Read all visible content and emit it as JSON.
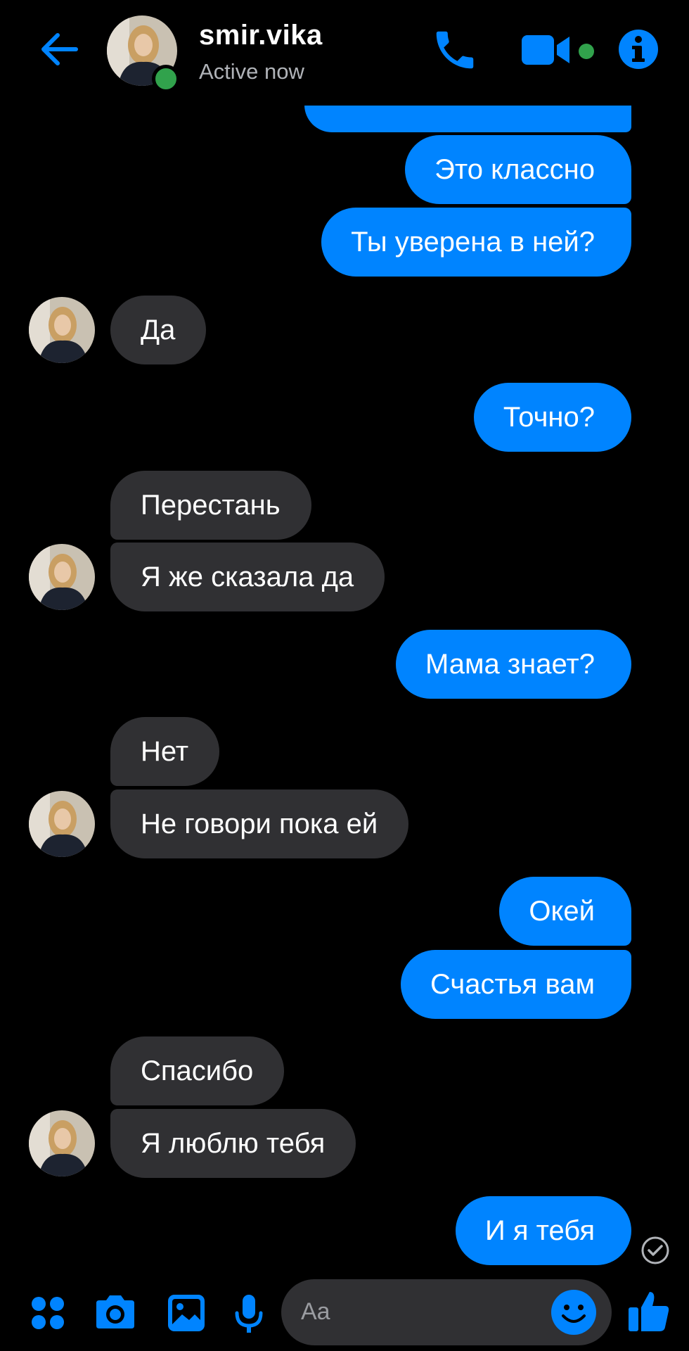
{
  "header": {
    "contact_name": "smir.vika",
    "status": "Active now"
  },
  "messages": [
    {
      "dir": "out",
      "text": "Это классно"
    },
    {
      "dir": "out",
      "text": "Ты уверена в ней?"
    },
    {
      "dir": "in",
      "text": "Да"
    },
    {
      "dir": "out",
      "text": "Точно?"
    },
    {
      "dir": "in",
      "text": "Перестань"
    },
    {
      "dir": "in",
      "text": "Я же сказала да"
    },
    {
      "dir": "out",
      "text": "Мама знает?"
    },
    {
      "dir": "in",
      "text": "Нет"
    },
    {
      "dir": "in",
      "text": "Не говори пока ей"
    },
    {
      "dir": "out",
      "text": "Окей"
    },
    {
      "dir": "out",
      "text": "Счастья вам"
    },
    {
      "dir": "in",
      "text": "Спасибо"
    },
    {
      "dir": "in",
      "text": "Я люблю тебя"
    },
    {
      "dir": "out",
      "text": "И я тебя"
    }
  ],
  "composer": {
    "placeholder": "Aa"
  },
  "colors": {
    "accent": "#0084ff",
    "incoming_bubble": "#303033",
    "online": "#31a24c",
    "background": "#000000"
  },
  "icons": [
    "back-arrow-icon",
    "phone-icon",
    "video-camera-icon",
    "info-icon",
    "apps-icon",
    "camera-icon",
    "gallery-icon",
    "microphone-icon",
    "emoji-icon",
    "thumbs-up-icon",
    "seen-check-icon"
  ]
}
